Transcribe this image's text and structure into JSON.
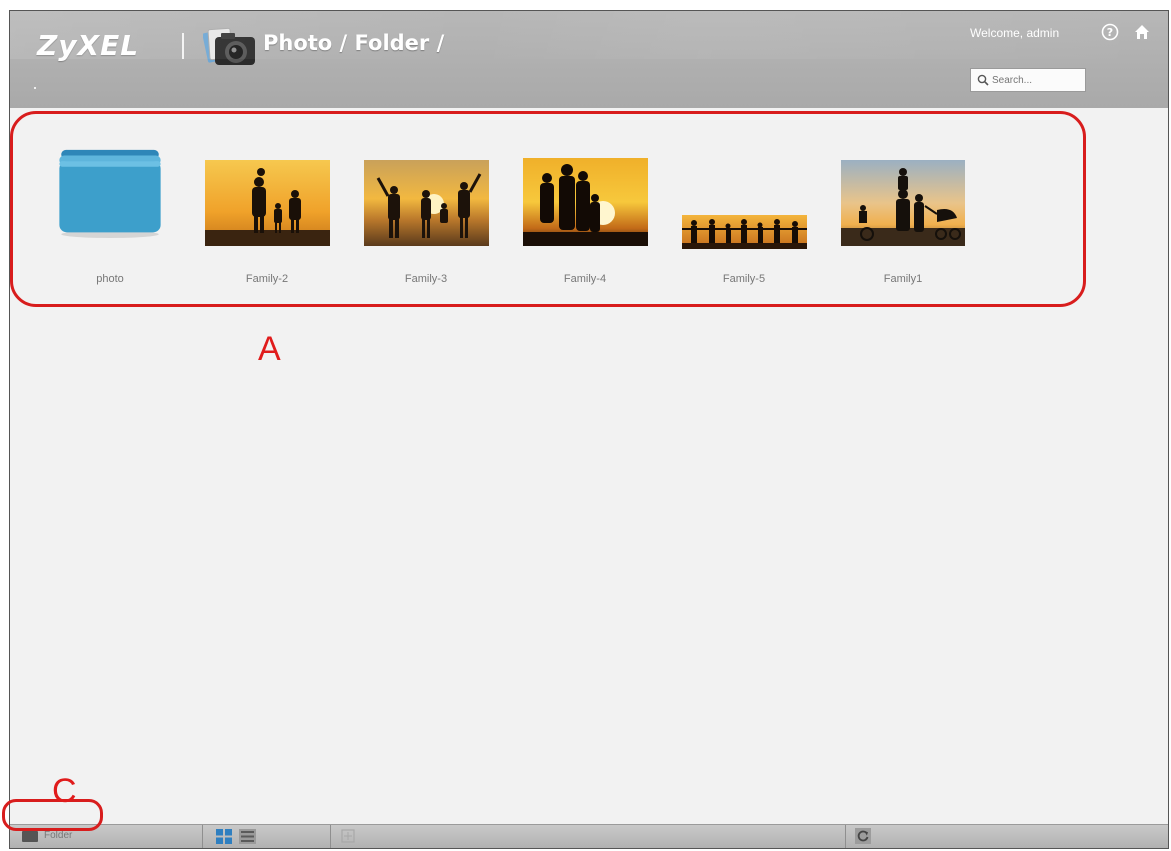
{
  "header": {
    "logo": "ZyXEL",
    "breadcrumb": "Photo / Folder /",
    "welcome": "Welcome, admin",
    "search_placeholder": "Search..."
  },
  "items": [
    {
      "label": "photo",
      "type": "folder",
      "icon": "folder-icon"
    },
    {
      "label": "Family-2",
      "type": "image"
    },
    {
      "label": "Family-3",
      "type": "image"
    },
    {
      "label": "Family-4",
      "type": "image"
    },
    {
      "label": "Family-5",
      "type": "image"
    },
    {
      "label": "Family1",
      "type": "image"
    }
  ],
  "annotations": {
    "a": "A",
    "c": "C"
  },
  "toolbar": {
    "folder_label": "Folder",
    "grid_icon": "grid-view-icon",
    "list_icon": "list-view-icon",
    "refresh_icon": "refresh-icon"
  },
  "colors": {
    "header": "#aaaaaa",
    "annotation": "#d81d1d",
    "folder": "#3d9fcb",
    "background": "#f2f2f2"
  }
}
